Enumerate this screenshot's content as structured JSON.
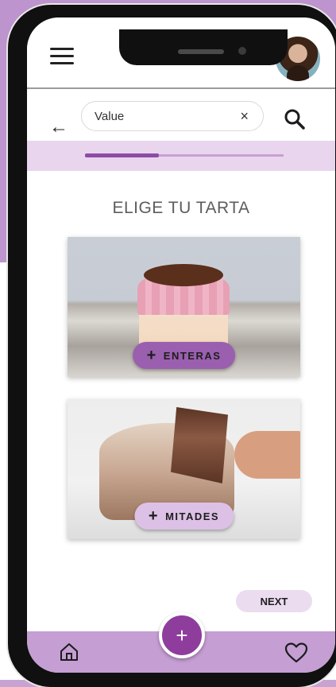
{
  "search": {
    "value": "Value",
    "clear": "×"
  },
  "progress": {
    "fraction": 0.37
  },
  "page_title": "ELIGE TU TARTA",
  "cards": [
    {
      "label": "ENTERAS",
      "plus": "+"
    },
    {
      "label": "MITADES",
      "plus": "+"
    }
  ],
  "next_label": "NEXT",
  "fab_label": "+",
  "colors": {
    "accent": "#8e3d9d",
    "pill_dark": "#9a5fae",
    "pill_light": "#dcc0e5",
    "progress_bg": "#e9d6ee",
    "bottom_bar": "#c59ed3"
  },
  "icons": [
    "menu-icon",
    "back-arrow-icon",
    "search-icon",
    "clear-icon",
    "home-icon",
    "heart-icon",
    "plus-icon"
  ]
}
